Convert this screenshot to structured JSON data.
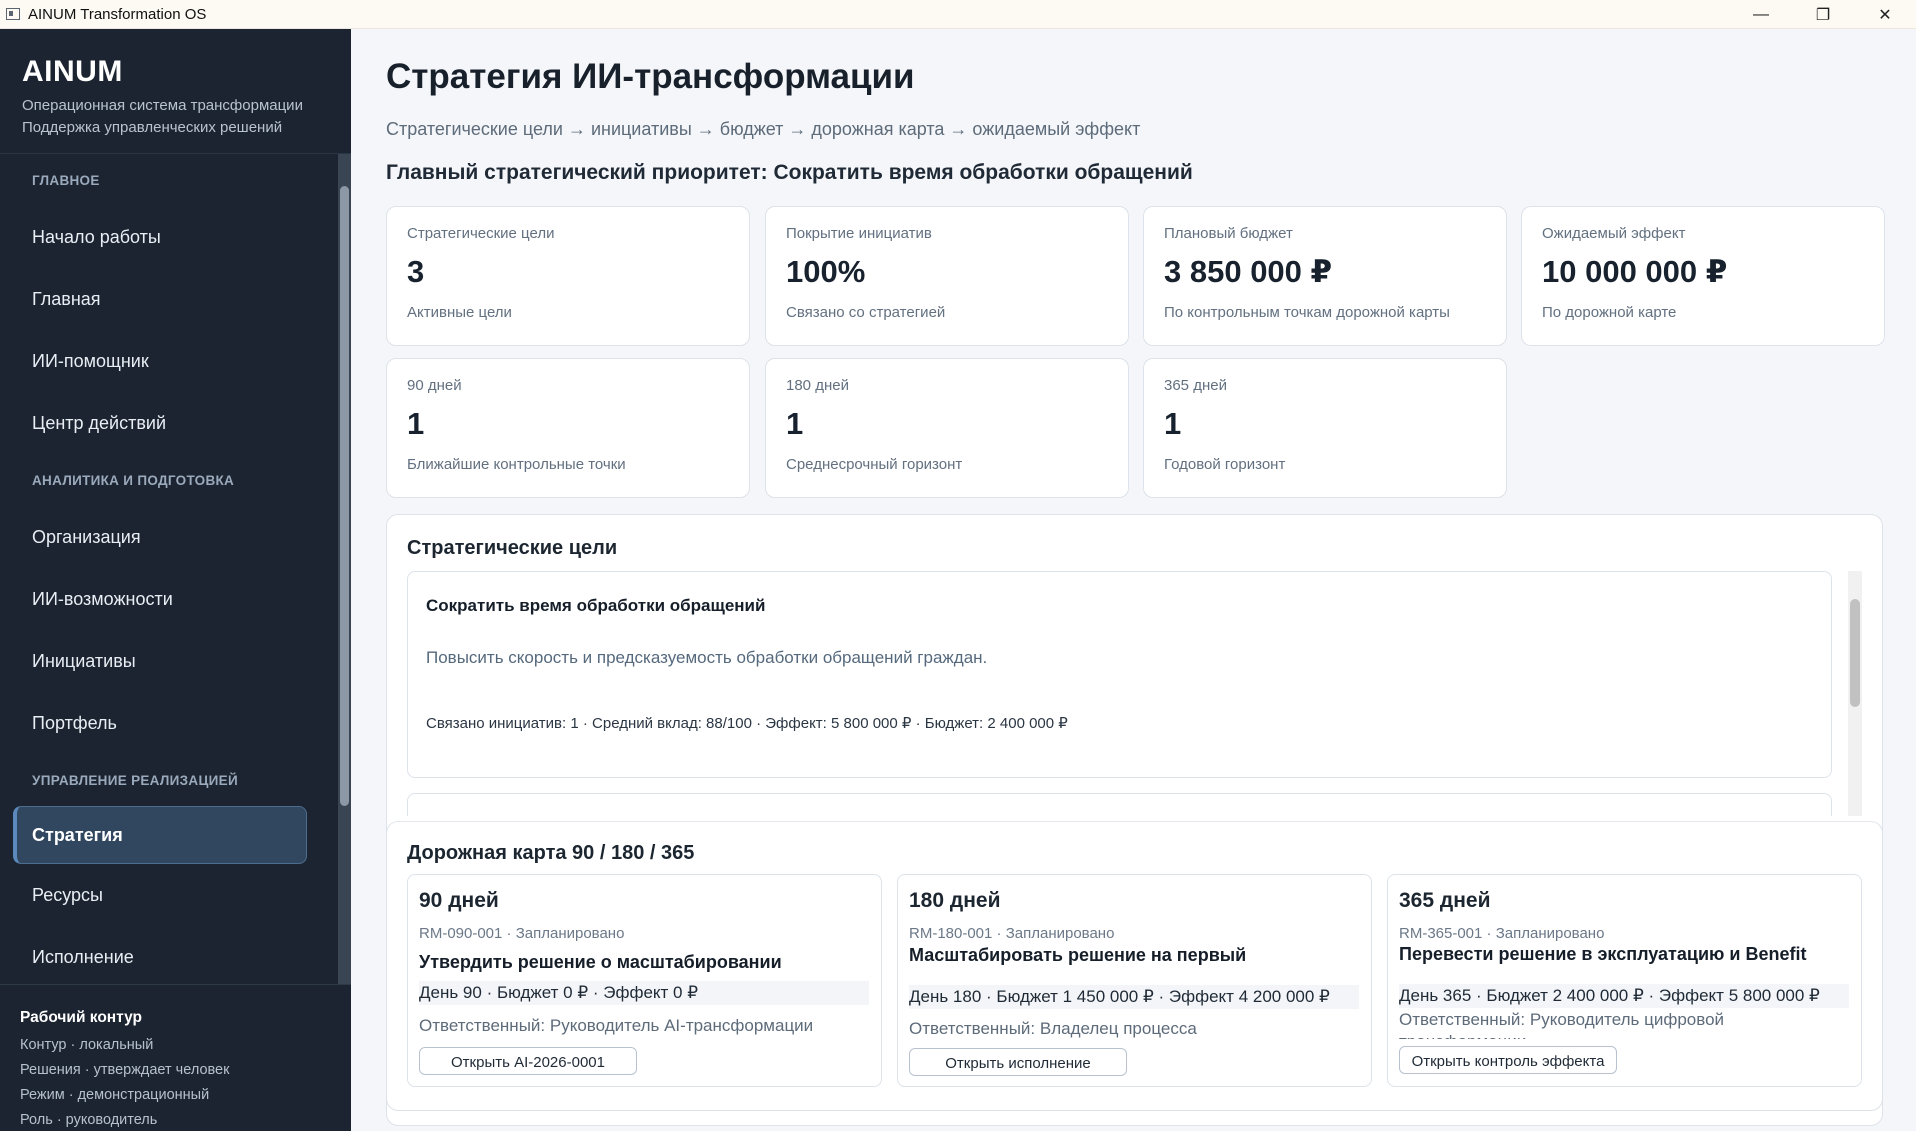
{
  "window": {
    "title": "AINUM Transformation OS",
    "controls": {
      "minimize": "—",
      "maximize": "❐",
      "close": "✕"
    }
  },
  "sidebar": {
    "brand": "AINUM",
    "brand_sub1": "Операционная система трансформации",
    "brand_sub2": "Поддержка управленческих решений",
    "sections": {
      "main": "ГЛАВНОЕ",
      "analytics": "АНАЛИТИКА И ПОДГОТОВКА",
      "execution": "УПРАВЛЕНИЕ РЕАЛИЗАЦИЕЙ"
    },
    "items": {
      "start": "Начало работы",
      "home": "Главная",
      "assistant": "ИИ-помощник",
      "actions": "Центр действий",
      "org": "Организация",
      "ai_opps": "ИИ-возможности",
      "initiatives": "Инициативы",
      "portfolio": "Портфель",
      "strategy": "Стратегия",
      "resources": "Ресурсы",
      "execution": "Исполнение"
    },
    "footer": {
      "title": "Рабочий контур",
      "line1": "Контур · локальный",
      "line2": "Решения · утверждает человек",
      "line3": "Режим · демонстрационный",
      "line4": "Роль · руководитель"
    }
  },
  "page": {
    "title": "Стратегия ИИ-трансформации",
    "subtitle": "Стратегические цели → инициативы → бюджет → дорожная карта → ожидаемый эффект",
    "priority": "Главный стратегический приоритет: Сократить время обработки обращений"
  },
  "kpis": [
    {
      "label": "Стратегические цели",
      "value": "3",
      "caption": "Активные цели"
    },
    {
      "label": "Покрытие инициатив",
      "value": "100%",
      "caption": "Связано со стратегией"
    },
    {
      "label": "Плановый бюджет",
      "value": "3 850 000 ₽",
      "caption": "По контрольным точкам дорожной карты"
    },
    {
      "label": "Ожидаемый эффект",
      "value": "10 000 000 ₽",
      "caption": "По дорожной карте"
    },
    {
      "label": "90 дней",
      "value": "1",
      "caption": "Ближайшие контрольные точки"
    },
    {
      "label": "180 дней",
      "value": "1",
      "caption": "Среднесрочный горизонт"
    },
    {
      "label": "365 дней",
      "value": "1",
      "caption": "Годовой горизонт"
    }
  ],
  "goals": {
    "title": "Стратегические цели",
    "items": [
      {
        "title": "Сократить время обработки обращений",
        "description": "Повысить скорость и предсказуемость обработки обращений граждан.",
        "meta": "Связано инициатив: 1 · Средний вклад: 88/100 · Эффект: 5 800 000 ₽ · Бюджет: 2 400 000 ₽"
      }
    ]
  },
  "roadmap": {
    "title": "Дорожная карта 90 / 180 / 365",
    "cards": [
      {
        "horizon": "90 дней",
        "id_status": "RM-090-001 · Запланировано",
        "name": "Утвердить решение о масштабировании",
        "stats": "День 90 · Бюджет 0 ₽ · Эффект 0 ₽",
        "owner": "Ответственный: Руководитель AI-трансформации",
        "button": "Открыть AI-2026-0001"
      },
      {
        "horizon": "180 дней",
        "id_status": "RM-180-001 · Запланировано",
        "name": "Масштабировать решение на первый производственный контур",
        "stats": "День 180 · Бюджет 1 450 000 ₽ · Эффект 4 200 000 ₽",
        "owner": "Ответственный: Владелец процесса",
        "button": "Открыть исполнение"
      },
      {
        "horizon": "365 дней",
        "id_status": "RM-365-001 · Запланировано",
        "name": "Перевести решение в эксплуатацию и Benefit Tracking",
        "stats": "День 365 · Бюджет 2 400 000 ₽ · Эффект 5 800 000 ₽",
        "owner": "Ответственный: Руководитель цифровой трансформации",
        "button": "Открыть контроль эффекта"
      }
    ]
  }
}
